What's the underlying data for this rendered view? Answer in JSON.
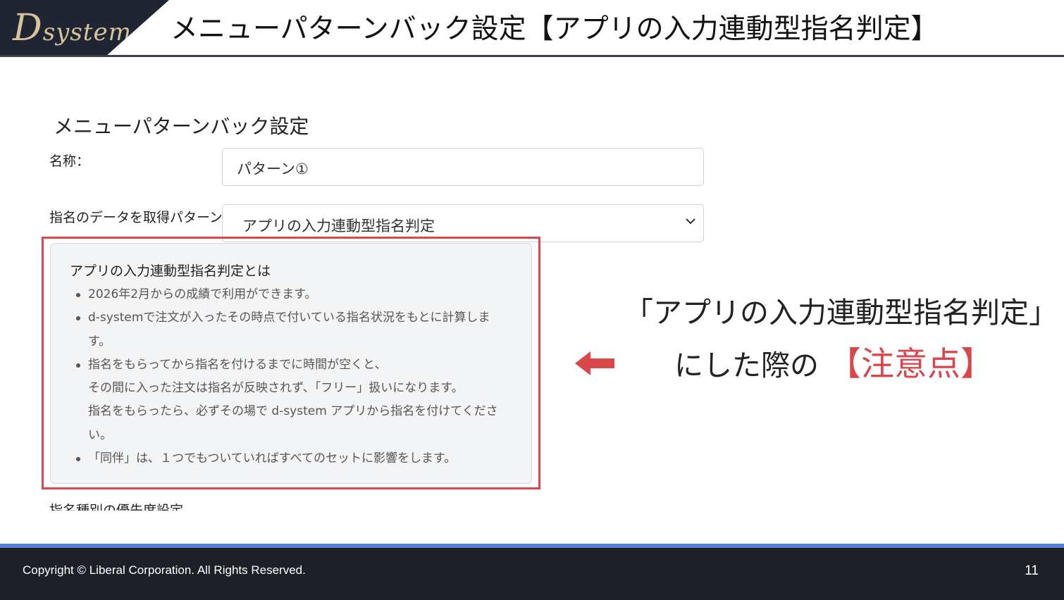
{
  "header": {
    "logo_text_big": "D",
    "logo_text_rest": "system",
    "title": "メニューパターンバック設定【アプリの入力連動型指名判定】"
  },
  "form": {
    "section_title": "メニューパターンバック設定",
    "name_label": "名称：",
    "name_value": "パターン①",
    "pattern_label": "指名のデータを取得パターン",
    "pattern_value": "アプリの入力連動型指名判定",
    "next_label": "指名種別の優先度設定"
  },
  "info": {
    "title": "アプリの入力連動型指名判定とは",
    "items": [
      {
        "lines": [
          "2026年2月からの成績で利用ができます。"
        ]
      },
      {
        "lines": [
          "d-systemで注文が入ったその時点で付いている指名状況をもとに計算しま",
          "す。"
        ]
      },
      {
        "lines": [
          "指名をもらってから指名を付けるまでに時間が空くと、",
          "その間に入った注文は指名が反映されず、「フリー」扱いになります。",
          "指名をもらったら、必ずその場で d-system アプリから指名を付けてくださ",
          "い。"
        ]
      },
      {
        "lines": [
          "「同伴」は、１つでもついていればすべてのセットに影響をします。"
        ]
      }
    ]
  },
  "note": {
    "line1": "「アプリの入力連動型指名判定」",
    "line2_prefix": "にした際の",
    "line2_accent": "【注意点】"
  },
  "footer": {
    "copyright": "Copyright ©  Liberal Corporation. All Rights Reserved.",
    "page": "11"
  },
  "colors": {
    "accent_red": "#d9474d",
    "header_dark": "#202534",
    "footer_dark": "#1e2027",
    "footer_stripe": "#5a7fd6",
    "logo_gold": "#d6c49a"
  },
  "icons": {
    "select_chevron": "chevron-down-icon",
    "annotation_arrow": "arrow-left-icon"
  }
}
